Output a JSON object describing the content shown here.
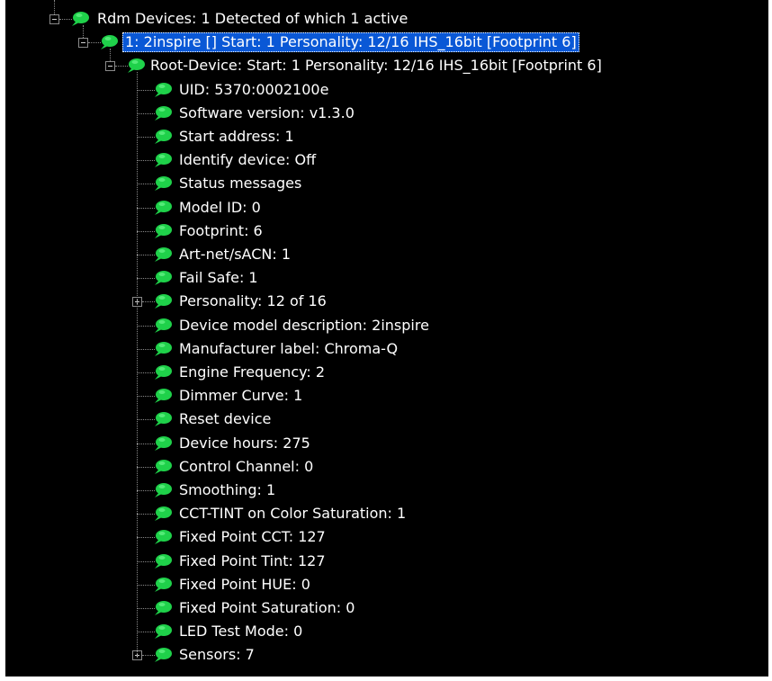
{
  "colors": {
    "background": "#000000",
    "text": "#ffffff",
    "selection": "#0a58d6",
    "bubble_icon": "#1fd14a",
    "tree_lines": "#8a8a8a"
  },
  "icon": "green-speech-bubble-icon",
  "tree": {
    "root": {
      "label": "Rdm Devices: 1 Detected of which 1 active",
      "expanded": true
    },
    "device": {
      "label": "1: 2inspire [] Start: 1 Personality: 12/16 IHS_16bit [Footprint 6]",
      "expanded": true,
      "selected": true
    },
    "root_device": {
      "label": "Root-Device: Start: 1 Personality: 12/16 IHS_16bit [Footprint 6]",
      "expanded": true
    },
    "items": [
      {
        "label": "UID: 5370:0002100e",
        "expandable": false
      },
      {
        "label": "Software version: v1.3.0",
        "expandable": false
      },
      {
        "label": "Start address: 1",
        "expandable": false
      },
      {
        "label": "Identify device: Off",
        "expandable": false
      },
      {
        "label": "Status messages",
        "expandable": false
      },
      {
        "label": "Model ID: 0",
        "expandable": false
      },
      {
        "label": "Footprint: 6",
        "expandable": false
      },
      {
        "label": "Art-net/sACN: 1",
        "expandable": false
      },
      {
        "label": "Fail Safe: 1",
        "expandable": false
      },
      {
        "label": "Personality: 12 of 16",
        "expandable": true
      },
      {
        "label": "Device model description: 2inspire",
        "expandable": false
      },
      {
        "label": "Manufacturer label: Chroma-Q",
        "expandable": false
      },
      {
        "label": "Engine Frequency: 2",
        "expandable": false
      },
      {
        "label": "Dimmer Curve: 1",
        "expandable": false
      },
      {
        "label": "Reset device",
        "expandable": false
      },
      {
        "label": "Device hours: 275",
        "expandable": false
      },
      {
        "label": "Control Channel: 0",
        "expandable": false
      },
      {
        "label": "Smoothing: 1",
        "expandable": false
      },
      {
        "label": "CCT-TINT on Color Saturation: 1",
        "expandable": false
      },
      {
        "label": "Fixed Point CCT: 127",
        "expandable": false
      },
      {
        "label": "Fixed Point Tint: 127",
        "expandable": false
      },
      {
        "label": "Fixed Point HUE: 0",
        "expandable": false
      },
      {
        "label": "Fixed Point Saturation: 0",
        "expandable": false
      },
      {
        "label": "LED Test Mode: 0",
        "expandable": false
      },
      {
        "label": "Sensors: 7",
        "expandable": true
      }
    ]
  }
}
